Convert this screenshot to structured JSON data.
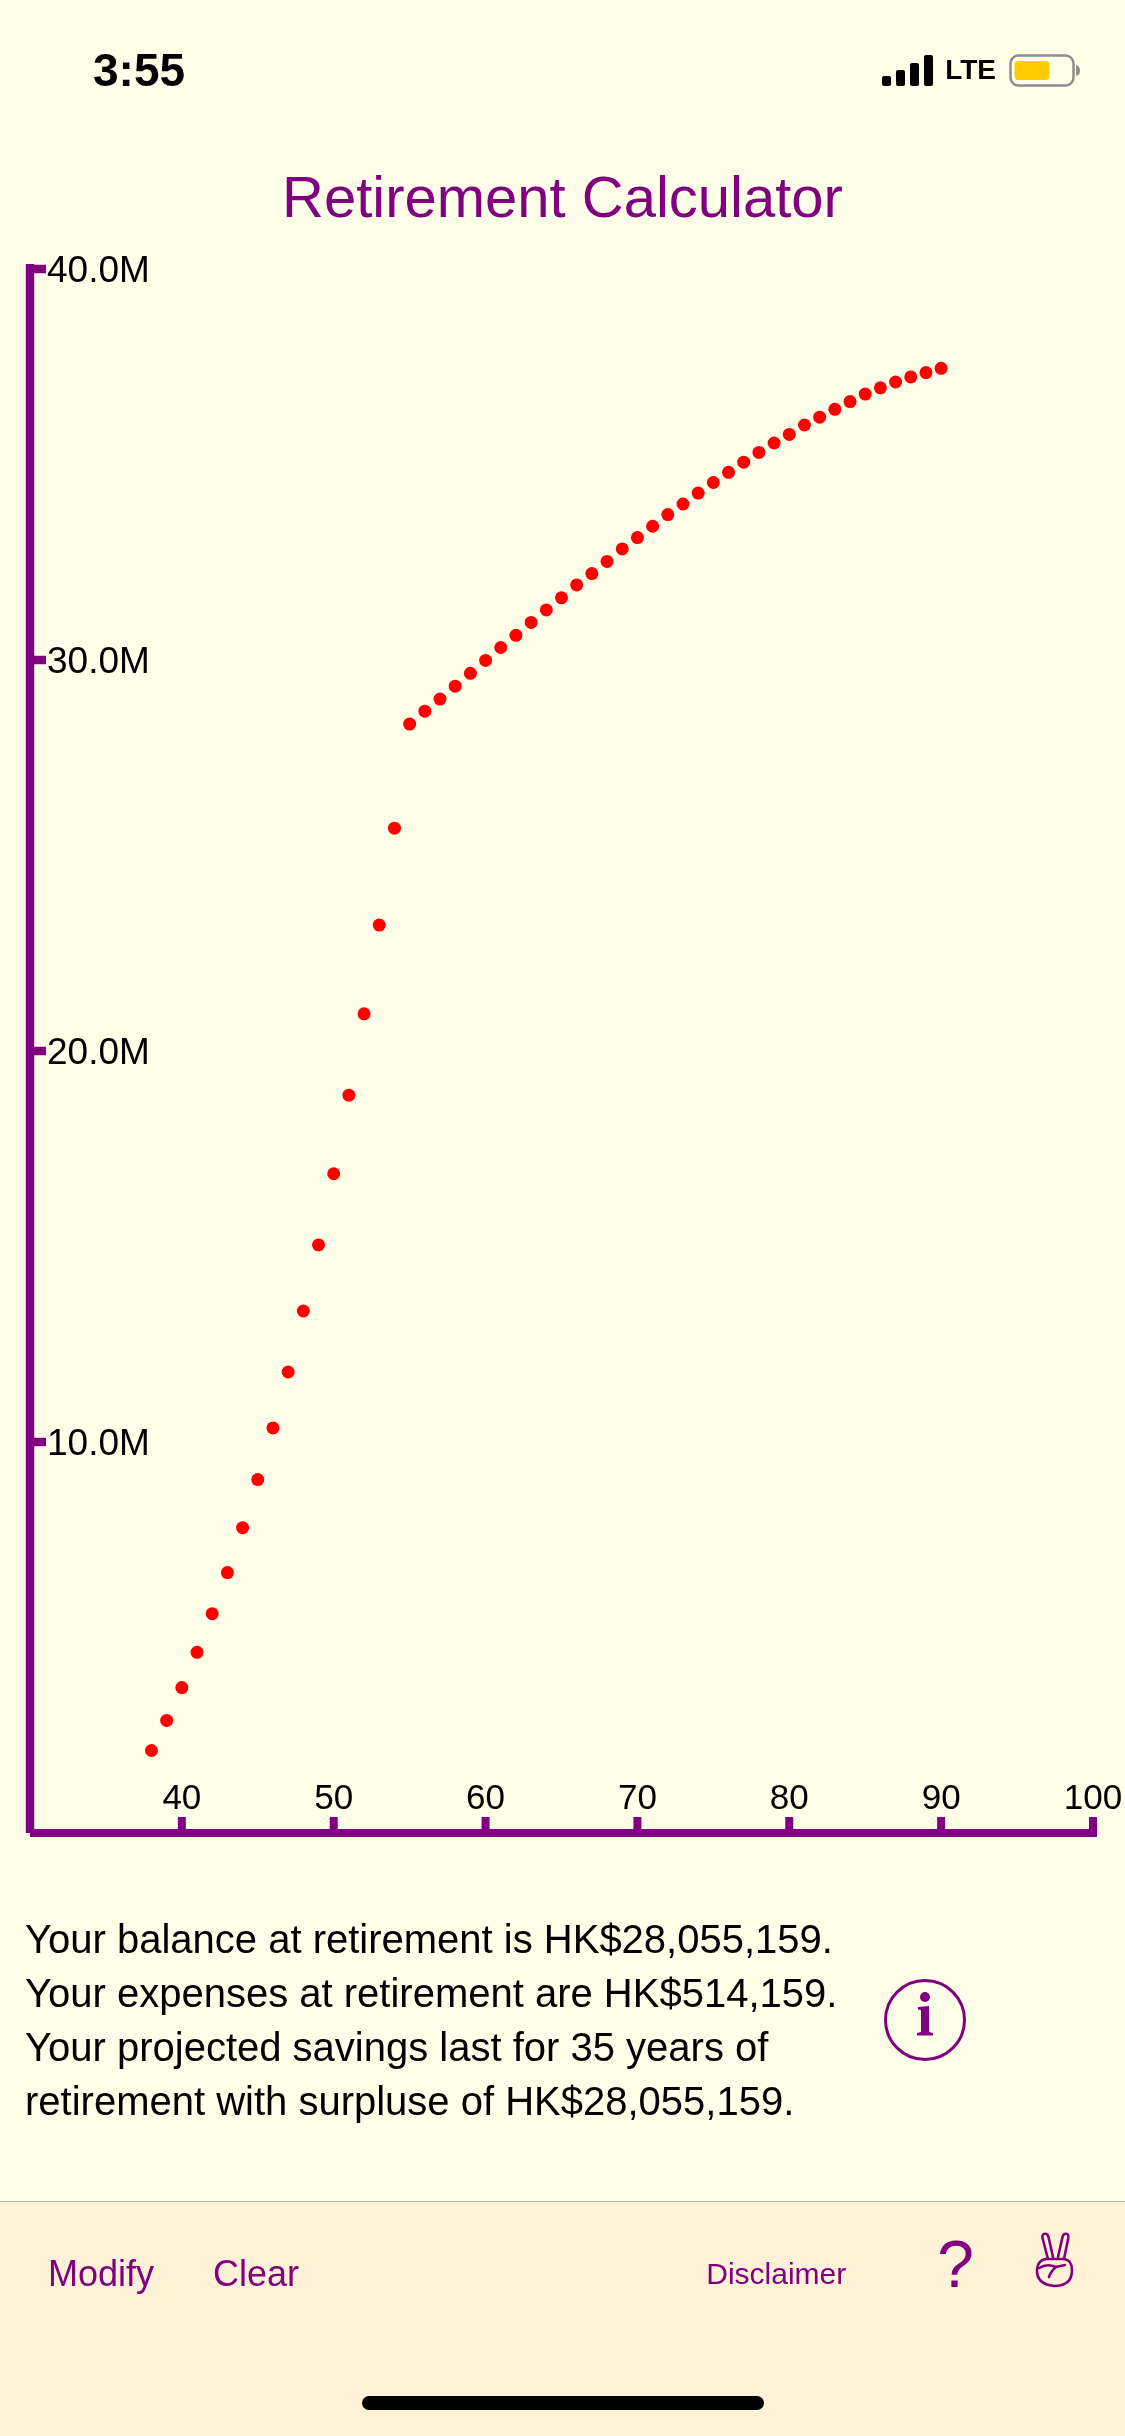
{
  "status_bar": {
    "time": "3:55",
    "network": "LTE"
  },
  "title": "Retirement Calculator",
  "chart": {
    "chart_data": {
      "type": "scatter",
      "x": [
        38,
        39,
        40,
        41,
        42,
        43,
        44,
        45,
        46,
        47,
        48,
        49,
        50,
        51,
        52,
        53,
        54,
        55,
        56,
        57,
        58,
        59,
        60,
        61,
        62,
        63,
        64,
        65,
        66,
        67,
        68,
        69,
        70,
        71,
        72,
        73,
        74,
        75,
        76,
        77,
        78,
        79,
        80,
        81,
        82,
        83,
        84,
        85,
        86,
        87,
        88,
        89,
        90
      ],
      "series": [
        {
          "color": "#ff0000",
          "values": [
            2.11,
            2.88,
            3.72,
            4.62,
            5.61,
            6.66,
            7.81,
            9.04,
            10.36,
            11.79,
            13.35,
            15.04,
            16.86,
            18.87,
            20.95,
            23.22,
            25.7,
            28.36,
            28.69,
            29.0,
            29.33,
            29.66,
            29.99,
            30.32,
            30.63,
            30.96,
            31.28,
            31.59,
            31.92,
            32.21,
            32.52,
            32.84,
            33.13,
            33.42,
            33.72,
            33.99,
            34.27,
            34.54,
            34.8,
            35.06,
            35.31,
            35.55,
            35.77,
            36.01,
            36.21,
            36.41,
            36.61,
            36.8,
            36.96,
            37.11,
            37.24,
            37.35,
            37.46
          ]
        }
      ],
      "xlim": [
        30,
        100
      ],
      "ylim": [
        0,
        40
      ],
      "xticks": [
        40,
        50,
        60,
        70,
        80,
        90,
        100
      ],
      "yticks": [
        {
          "value": 10,
          "label": "10.0M"
        },
        {
          "value": 20,
          "label": "20.0M"
        },
        {
          "value": 30,
          "label": "30.0M"
        },
        {
          "value": 40,
          "label": "40.0M"
        }
      ]
    }
  },
  "summary": [
    "Your balance at retirement is HK$28,055,159.",
    "Your expenses at retirement are HK$514,159.",
    "Your projected savings last for 35 years of retirement with surpluse of HK$28,055,159."
  ],
  "toolbar": {
    "left": [
      {
        "label": "Modify",
        "kind": "action"
      },
      {
        "label": "Clear",
        "kind": "action"
      }
    ],
    "right": [
      {
        "label": "Disclaimer",
        "kind": "link"
      },
      {
        "label": "?",
        "kind": "symbol"
      }
    ]
  }
}
